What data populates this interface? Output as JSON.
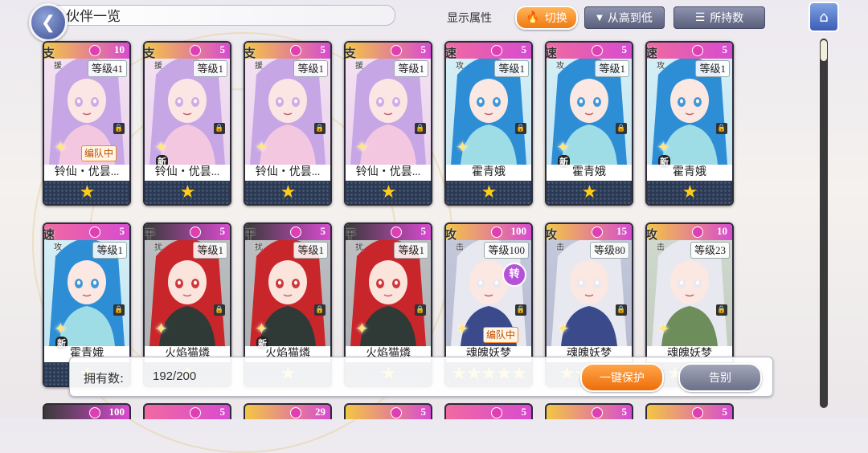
{
  "header": {
    "title": "伙伴一览",
    "attr_label": "显示属性",
    "switch_label": "切换",
    "sort_order_label": "从高到低",
    "sort_key_label": "所持数"
  },
  "cards_row1": [
    {
      "role": "支",
      "role2": "援",
      "count": "10",
      "level": "等级41",
      "name": "铃仙・优昙...",
      "stars": "★",
      "badge": "编队中",
      "new": "",
      "theme": "purple"
    },
    {
      "role": "支",
      "role2": "援",
      "count": "5",
      "level": "等级1",
      "name": "铃仙・优昙...",
      "stars": "★",
      "badge": "",
      "new": "新",
      "theme": "purple"
    },
    {
      "role": "支",
      "role2": "援",
      "count": "5",
      "level": "等级1",
      "name": "铃仙・优昙...",
      "stars": "★",
      "badge": "",
      "new": "",
      "theme": "purple"
    },
    {
      "role": "支",
      "role2": "援",
      "count": "5",
      "level": "等级1",
      "name": "铃仙・优昙...",
      "stars": "★",
      "badge": "",
      "new": "",
      "theme": "purple"
    },
    {
      "role": "速",
      "role2": "攻",
      "count": "5",
      "level": "等级1",
      "name": "霍青娥",
      "stars": "★",
      "badge": "",
      "new": "",
      "theme": "blue"
    },
    {
      "role": "速",
      "role2": "攻",
      "count": "5",
      "level": "等级1",
      "name": "霍青娥",
      "stars": "★",
      "badge": "",
      "new": "新",
      "theme": "blue"
    },
    {
      "role": "速",
      "role2": "攻",
      "count": "5",
      "level": "等级1",
      "name": "霍青娥",
      "stars": "★",
      "badge": "",
      "new": "新",
      "theme": "blue"
    }
  ],
  "cards_row2": [
    {
      "role": "速",
      "role2": "攻",
      "count": "5",
      "level": "等级1",
      "name": "霍青娥",
      "stars": "★",
      "badge": "",
      "new": "新",
      "theme": "blue"
    },
    {
      "role": "干",
      "role2": "扰",
      "count": "5",
      "level": "等级1",
      "name": "火焰猫燐",
      "stars": "★",
      "badge": "",
      "new": "",
      "theme": "red"
    },
    {
      "role": "干",
      "role2": "扰",
      "count": "5",
      "level": "等级1",
      "name": "火焰猫燐",
      "stars": "★",
      "badge": "",
      "new": "新",
      "theme": "red"
    },
    {
      "role": "干",
      "role2": "扰",
      "count": "5",
      "level": "等级1",
      "name": "火焰猫燐",
      "stars": "★",
      "badge": "",
      "new": "",
      "theme": "red"
    },
    {
      "role": "攻",
      "role2": "击",
      "count": "100",
      "level": "等级100",
      "name": "魂魄妖梦",
      "stars": "★★★★★",
      "badge": "编队中",
      "new": "",
      "theme": "white",
      "rotate": "转"
    },
    {
      "role": "攻",
      "role2": "击",
      "count": "15",
      "level": "等级80",
      "name": "魂魄妖梦",
      "stars": "★★★★",
      "badge": "",
      "new": "",
      "theme": "white"
    },
    {
      "role": "攻",
      "role2": "击",
      "count": "10",
      "level": "等级23",
      "name": "魂魄妖梦",
      "stars": "★★★",
      "badge": "",
      "new": "",
      "theme": "green"
    }
  ],
  "row3_counts": [
    "100",
    "5",
    "29",
    "5",
    "5",
    "5",
    "5"
  ],
  "footer": {
    "owned_label": "拥有数:",
    "owned_value": "192/200",
    "protect_label": "一键保护",
    "farewell_label": "告别"
  },
  "colors": {
    "purple_hair": "#c7a6e6",
    "blue_hair": "#2d8ed6",
    "red_hair": "#c8262a",
    "white_hair": "#e8e8f0",
    "accent_orange": "#f07a10"
  }
}
